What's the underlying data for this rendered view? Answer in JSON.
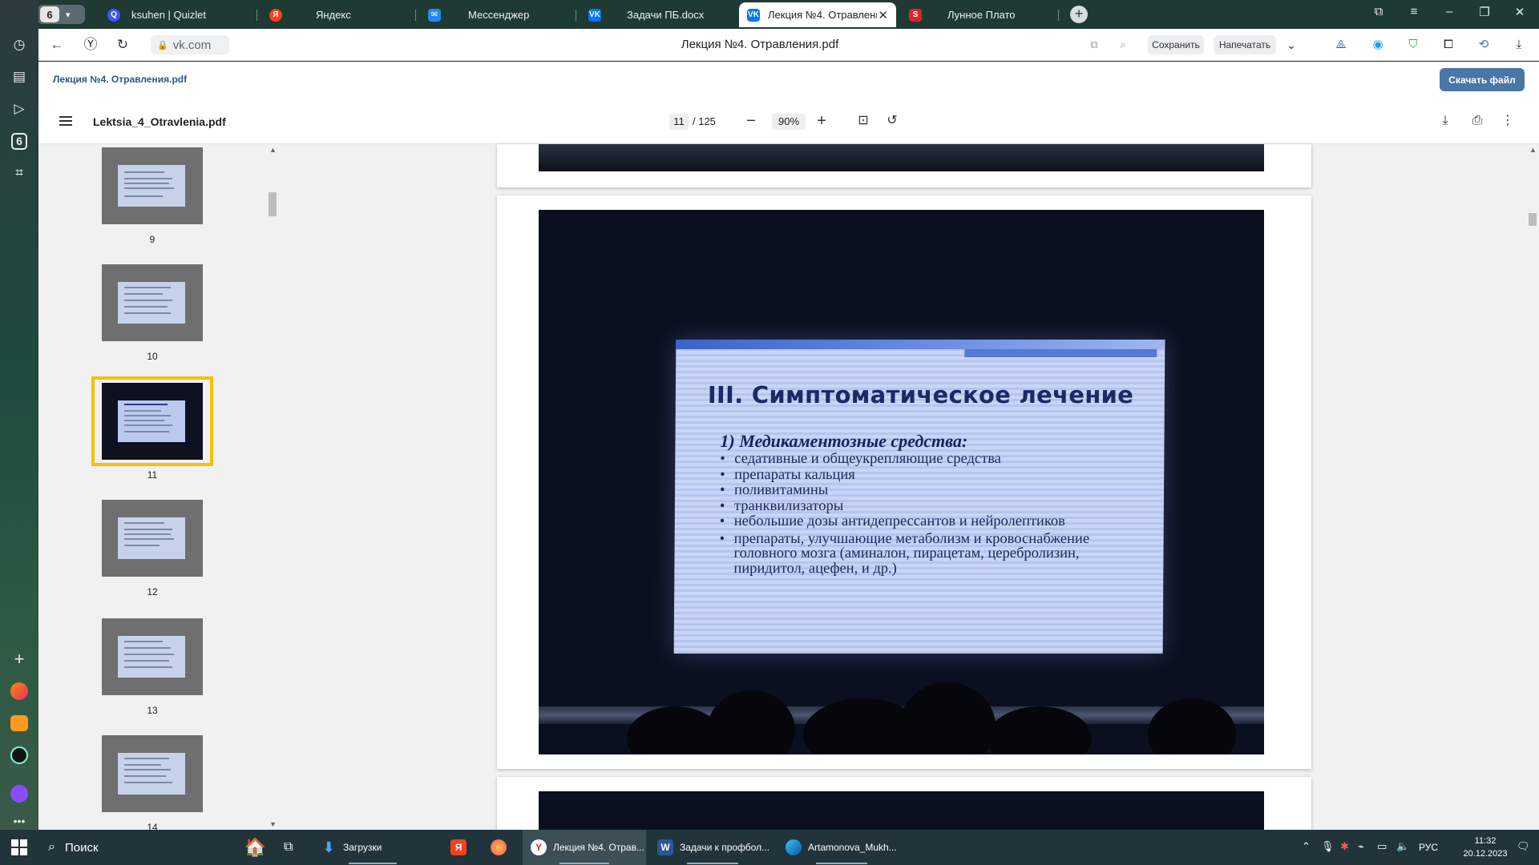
{
  "browser": {
    "tab_group_count": "6",
    "tabs": [
      {
        "label": "ksuhen | Quizlet",
        "icon": "quizlet-icon"
      },
      {
        "label": "Яндекс",
        "icon": "yandex-icon"
      },
      {
        "label": "Мессенджер",
        "icon": "messenger-icon"
      },
      {
        "label": "Задачи ПБ.docx",
        "icon": "vk-icon"
      },
      {
        "label": "Лекция №4. Отравления",
        "icon": "vk-icon",
        "active": true
      },
      {
        "label": "Лунное Плато",
        "icon": "s-icon"
      }
    ],
    "address": "vk.com",
    "page_title": "Лекция №4. Отравления.pdf",
    "save_label": "Сохранить",
    "print_label": "Напечатать",
    "rail_badge": "6"
  },
  "vk": {
    "doc_title": "Лекция №4. Отравления.pdf",
    "download_label": "Скачать файл"
  },
  "pdf": {
    "file_name": "Lektsia_4_Otravlenia.pdf",
    "current_page": "11",
    "total_pages": "/ 125",
    "zoom": "90%",
    "thumbnails": [
      "9",
      "10",
      "11",
      "12",
      "13",
      "14"
    ],
    "selected_thumbnail": "11"
  },
  "slide": {
    "title": "III. Симптоматическое лечение",
    "subtitle": "1) Медикаментозные средства:",
    "items": [
      "седативные и общеукрепляющие средства",
      "препараты кальция",
      "поливитамины",
      "транквилизаторы",
      "небольшие дозы антидепрессантов и нейролептиков",
      " препараты, улучшающие метаболизм и кровоснабжение головного мозга (аминалон, пирацетам, церебролизин, пиридитол, ацефен, и др.)"
    ]
  },
  "taskbar": {
    "search_label": "Поиск",
    "apps": [
      {
        "label": "Загрузки",
        "icon": "folder-download-icon"
      },
      {
        "label": "",
        "icon": "yandex-browser-icon"
      },
      {
        "label": "",
        "icon": "firefox-icon"
      },
      {
        "label": "Лекция №4. Отрав...",
        "icon": "yandex-browser-icon"
      },
      {
        "label": "Задачи к профбол...",
        "icon": "word-icon"
      },
      {
        "label": "Artamonova_Mukh...",
        "icon": "edge-icon"
      }
    ],
    "language": "РУС",
    "time": "11:32",
    "date": "20.12.2023"
  },
  "colors": {
    "accent": "#4a76a8",
    "selection": "#f2c200",
    "link": "#2a5885"
  }
}
